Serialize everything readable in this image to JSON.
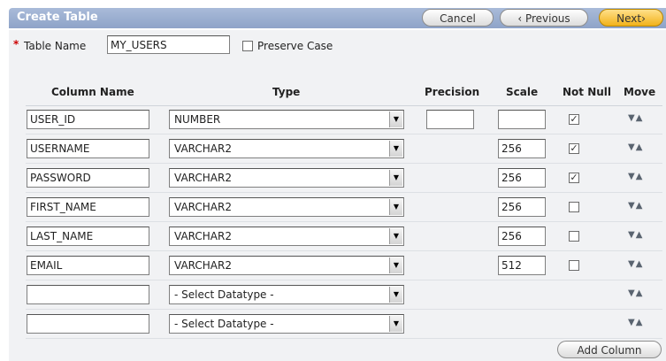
{
  "header": {
    "title": "Create Table",
    "cancel_label": "Cancel",
    "previous_label": "‹ Previous",
    "next_label": "Next›"
  },
  "form": {
    "required_marker": "*",
    "table_name_label": "Table Name",
    "table_name_value": "MY_USERS",
    "preserve_case_label": "Preserve Case",
    "preserve_case_checked": false
  },
  "columns": {
    "headers": {
      "name": "Column Name",
      "type": "Type",
      "precision": "Precision",
      "scale": "Scale",
      "not_null": "Not Null",
      "move": "Move"
    },
    "rows": [
      {
        "name": "USER_ID",
        "type": "NUMBER",
        "precision": "",
        "scale": "",
        "show_precision": true,
        "show_scale": true,
        "not_null": true,
        "show_not_null": true
      },
      {
        "name": "USERNAME",
        "type": "VARCHAR2",
        "precision": "",
        "scale": "256",
        "show_precision": false,
        "show_scale": true,
        "not_null": true,
        "show_not_null": true
      },
      {
        "name": "PASSWORD",
        "type": "VARCHAR2",
        "precision": "",
        "scale": "256",
        "show_precision": false,
        "show_scale": true,
        "not_null": true,
        "show_not_null": true
      },
      {
        "name": "FIRST_NAME",
        "type": "VARCHAR2",
        "precision": "",
        "scale": "256",
        "show_precision": false,
        "show_scale": true,
        "not_null": false,
        "show_not_null": true
      },
      {
        "name": "LAST_NAME",
        "type": "VARCHAR2",
        "precision": "",
        "scale": "256",
        "show_precision": false,
        "show_scale": true,
        "not_null": false,
        "show_not_null": true
      },
      {
        "name": "EMAIL",
        "type": "VARCHAR2",
        "precision": "",
        "scale": "512",
        "show_precision": false,
        "show_scale": true,
        "not_null": false,
        "show_not_null": true
      },
      {
        "name": "",
        "type": "- Select Datatype -",
        "precision": "",
        "scale": "",
        "show_precision": false,
        "show_scale": false,
        "not_null": false,
        "show_not_null": false
      },
      {
        "name": "",
        "type": "- Select Datatype -",
        "precision": "",
        "scale": "",
        "show_precision": false,
        "show_scale": false,
        "not_null": false,
        "show_not_null": false
      }
    ],
    "move_glyph": "▼▲",
    "check_glyph": "✓"
  },
  "footer": {
    "add_column_label": "Add Column"
  },
  "colors": {
    "title_bar": "#8ea3c8",
    "next_button": "#f2b21a",
    "panel": "#f1f2f4"
  }
}
